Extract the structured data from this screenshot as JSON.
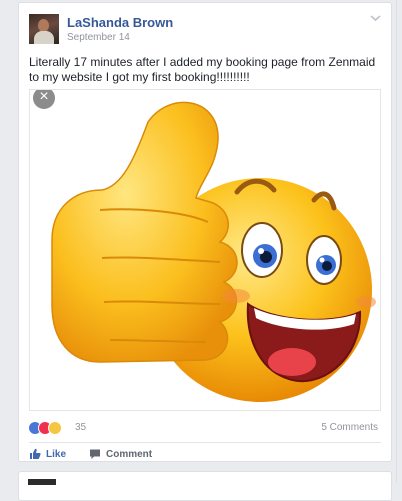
{
  "post": {
    "author": "LaShanda Brown",
    "date": "September 14",
    "text": "Literally 17 minutes after I added my booking page from Zenmaid to my website I got my first booking!!!!!!!!!!",
    "image_icon": "thumbs-up-smiley-emoji",
    "close_glyph": "×",
    "reaction_icons": [
      "like-reaction-icon",
      "love-reaction-icon",
      "wow-reaction-icon"
    ],
    "reaction_count": "35",
    "comments_label": "5 Comments",
    "actions": {
      "like": "Like",
      "comment": "Comment"
    },
    "colors": {
      "author": "#365899",
      "like": "#4267b2",
      "meta": "#90949c"
    }
  }
}
